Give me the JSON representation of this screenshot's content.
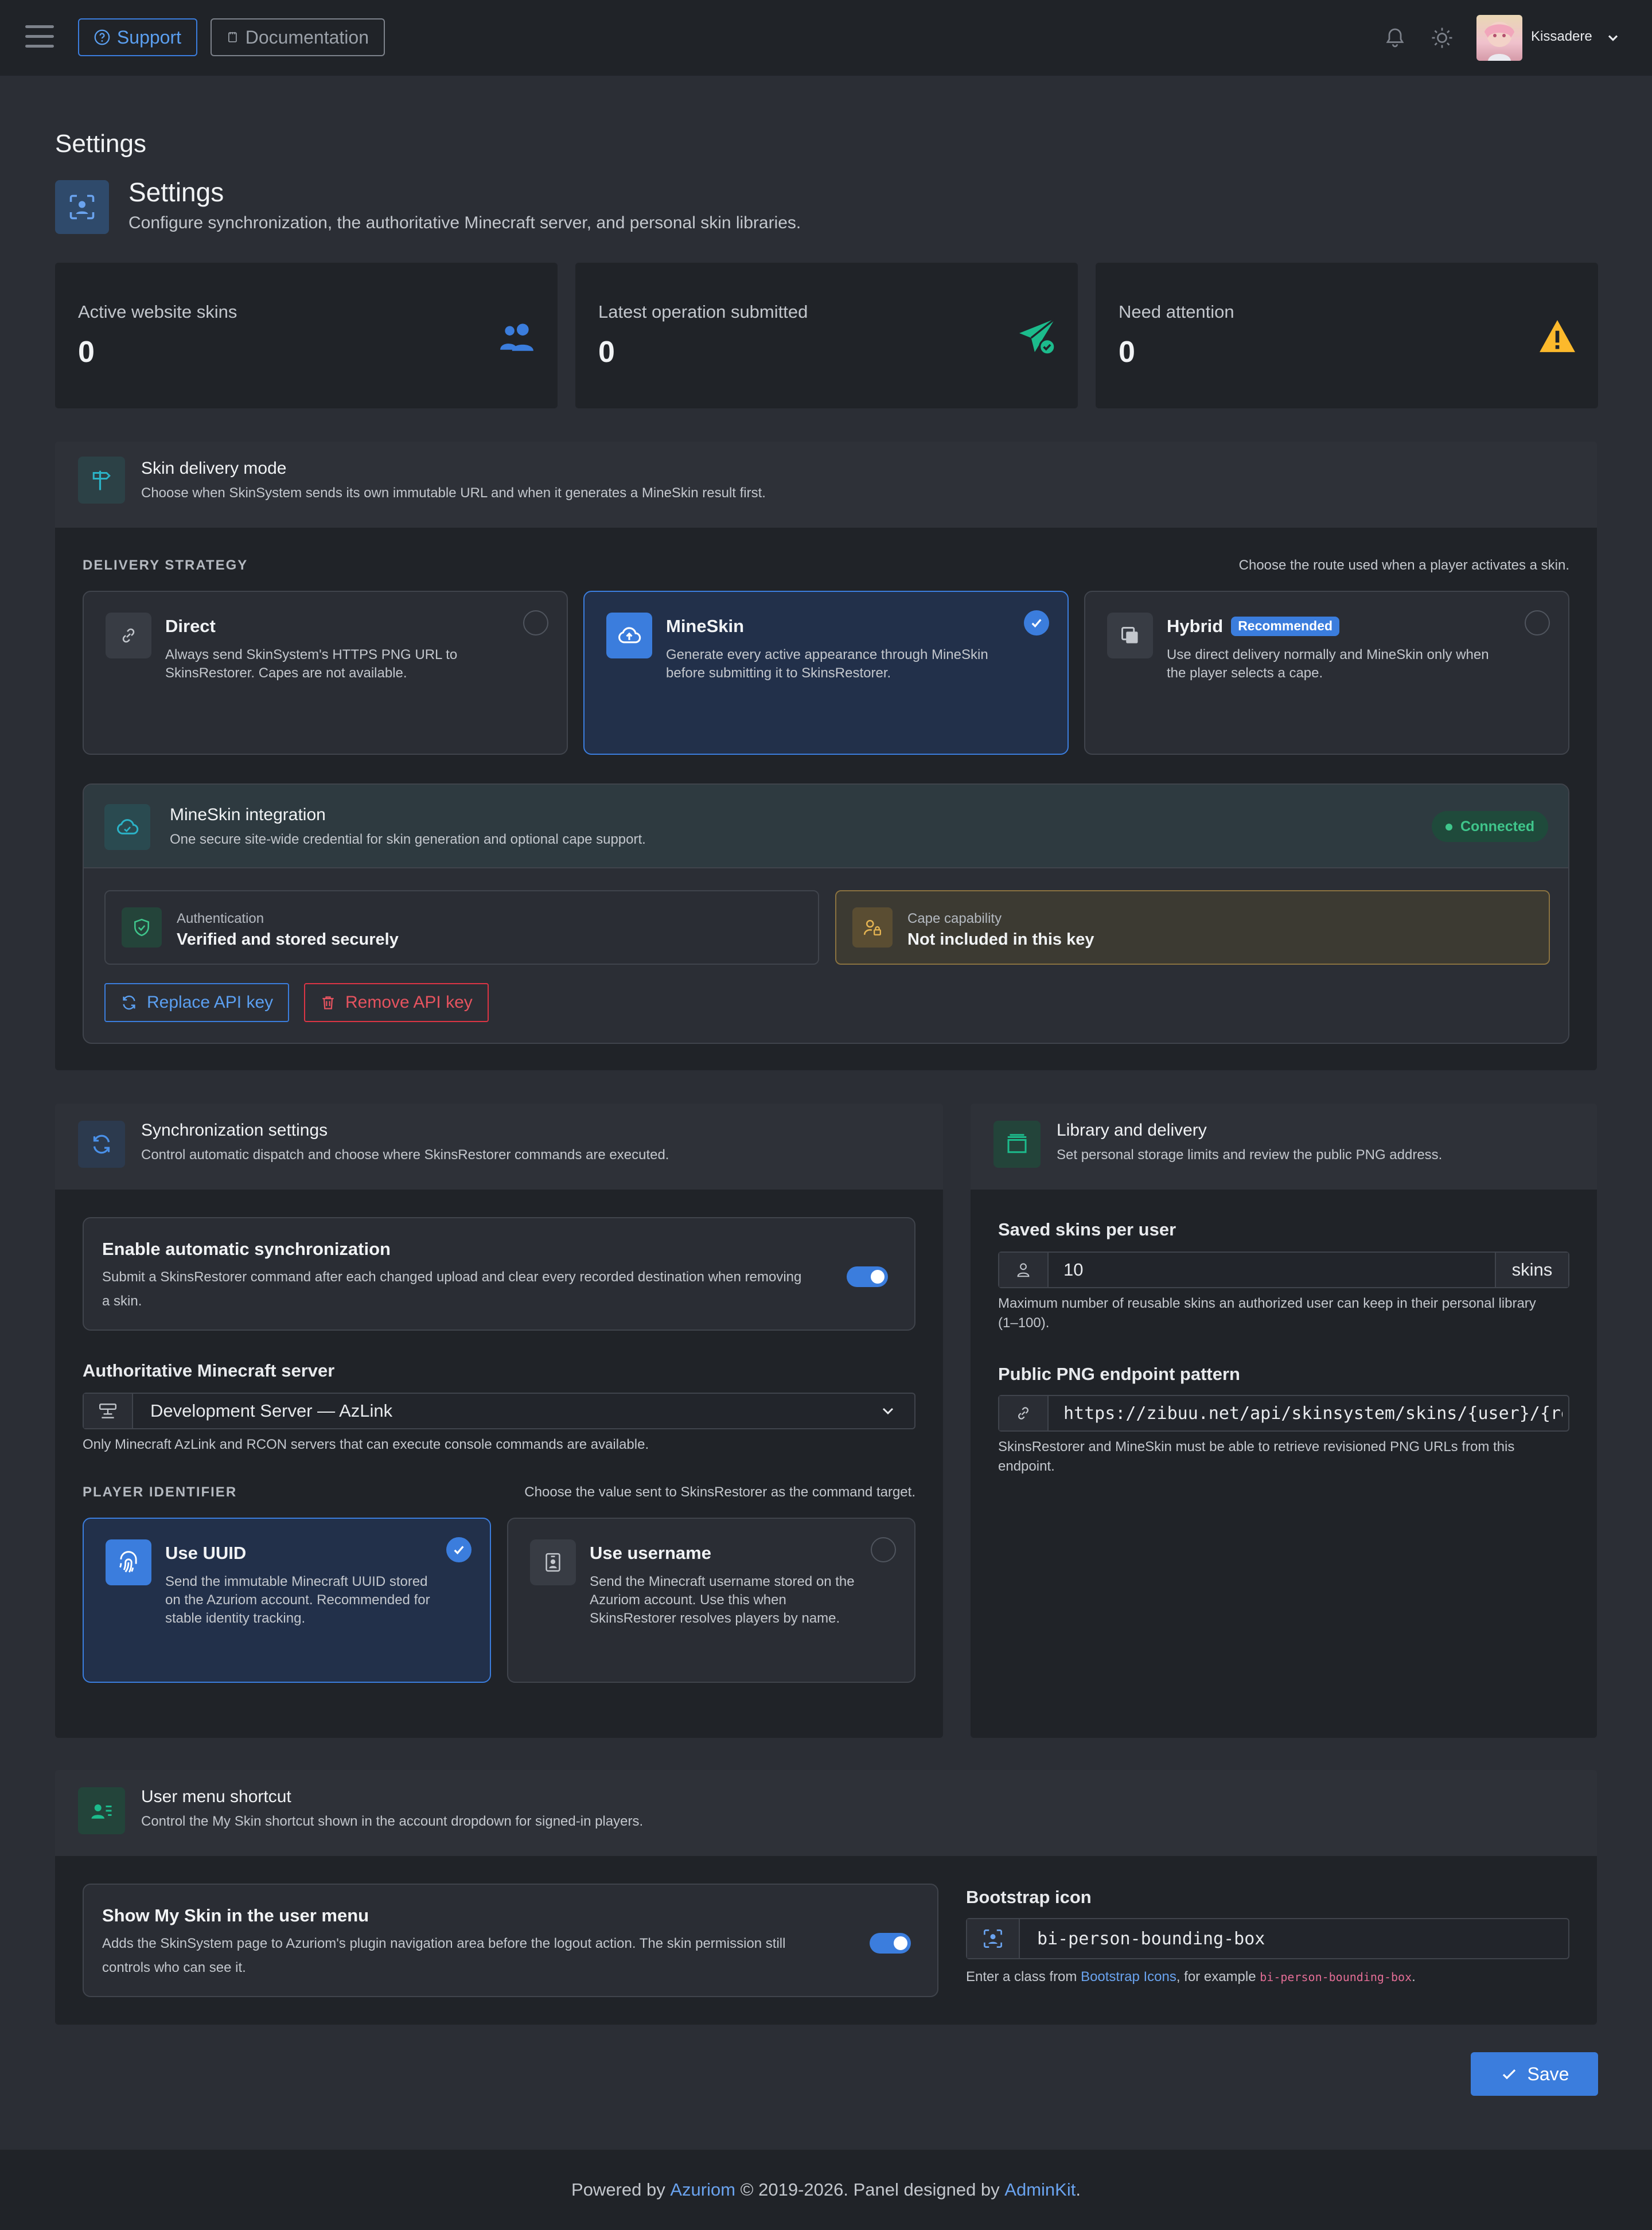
{
  "navbar": {
    "support_label": "Support",
    "docs_label": "Documentation",
    "username": "Kissadere"
  },
  "page": {
    "heading": "Settings",
    "title": "Settings",
    "subtitle": "Configure synchronization, the authoritative Minecraft server, and personal skin libraries."
  },
  "stats": [
    {
      "label": "Active website skins",
      "value": "0",
      "icon": "people-icon"
    },
    {
      "label": "Latest operation submitted",
      "value": "0",
      "icon": "send-check-icon"
    },
    {
      "label": "Need attention",
      "value": "0",
      "icon": "warning-icon"
    }
  ],
  "delivery": {
    "title": "Skin delivery mode",
    "subtitle": "Choose when SkinSystem sends its own immutable URL and when it generates a MineSkin result first.",
    "strategy_label": "DELIVERY STRATEGY",
    "strategy_hint": "Choose the route used when a player activates a skin.",
    "options": [
      {
        "title": "Direct",
        "desc1": "Always send SkinSystem's HTTPS PNG URL to",
        "desc2": "SkinsRestorer. Capes are not available.",
        "selected": false,
        "icon": "link-icon"
      },
      {
        "title": "MineSkin",
        "desc1": "Generate every active appearance through MineSkin",
        "desc2": "before submitting it to SkinsRestorer.",
        "selected": true,
        "icon": "cloud-upload-icon"
      },
      {
        "title": "Hybrid",
        "badge": "Recommended",
        "desc1": "Use direct delivery normally and MineSkin only when",
        "desc2": "the player selects a cape.",
        "selected": false,
        "icon": "layers-icon"
      }
    ],
    "integration": {
      "title": "MineSkin integration",
      "subtitle": "One secure site-wide credential for skin generation and optional cape support.",
      "status": "Connected",
      "auth_label": "Authentication",
      "auth_value": "Verified and stored securely",
      "cape_label": "Cape capability",
      "cape_value": "Not included in this key",
      "replace_label": "Replace API key",
      "remove_label": "Remove API key"
    }
  },
  "sync": {
    "title": "Synchronization settings",
    "subtitle": "Control automatic dispatch and choose where SkinsRestorer commands are executed.",
    "auto_title": "Enable automatic synchronization",
    "auto_desc1": "Submit a SkinsRestorer command after each changed upload and clear every recorded destination when removing",
    "auto_desc2": "a skin.",
    "auto_enabled": true,
    "server_label": "Authoritative Minecraft server",
    "server_value": "Development Server — AzLink",
    "server_help": "Only Minecraft AzLink and RCON servers that can execute console commands are available.",
    "identifier_label": "PLAYER IDENTIFIER",
    "identifier_hint": "Choose the value sent to SkinsRestorer as the command target.",
    "identifier_options": [
      {
        "title": "Use UUID",
        "desc1": "Send the immutable Minecraft UUID stored",
        "desc2": "on the Azuriom account. Recommended for",
        "desc3": "stable identity tracking.",
        "selected": true,
        "icon": "fingerprint-icon"
      },
      {
        "title": "Use username",
        "desc1": "Send the Minecraft username stored on the",
        "desc2": "Azuriom account. Use this when",
        "desc3": "SkinsRestorer resolves players by name.",
        "selected": false,
        "icon": "person-badge-icon"
      }
    ]
  },
  "library": {
    "title": "Library and delivery",
    "subtitle": "Set personal storage limits and review the public PNG address.",
    "saved_label": "Saved skins per user",
    "saved_value": "10",
    "saved_suffix": "skins",
    "saved_help1": "Maximum number of reusable skins an authorized user can keep in their personal library",
    "saved_help2": "(1–100).",
    "endpoint_label": "Public PNG endpoint pattern",
    "endpoint_value": "https://zibuu.net/api/skinsystem/skins/{user}/{re",
    "endpoint_help1": "SkinsRestorer and MineSkin must be able to retrieve revisioned PNG URLs from this",
    "endpoint_help2": "endpoint."
  },
  "usermenu": {
    "title": "User menu shortcut",
    "subtitle": "Control the My Skin shortcut shown in the account dropdown for signed-in players.",
    "show_title": "Show My Skin in the user menu",
    "show_desc1": "Adds the SkinSystem page to Azuriom's plugin navigation area before the logout action. The skin permission still",
    "show_desc2": "controls who can see it.",
    "show_enabled": true,
    "icon_label": "Bootstrap icon",
    "icon_value": "bi-person-bounding-box",
    "icon_help_prefix": "Enter a class from ",
    "icon_help_link": "Bootstrap Icons",
    "icon_help_middle": ", for example ",
    "icon_help_code": "bi-person-bounding-box",
    "icon_help_suffix": "."
  },
  "actions": {
    "save_label": "Save"
  },
  "footer": {
    "prefix": "Powered by ",
    "azuriom": "Azuriom",
    "middle": " © 2019-2026. Panel designed by ",
    "adminkit": "AdminKit",
    "suffix": "."
  },
  "colors": {
    "accent": "#3b7ddd",
    "success": "#3fc58b",
    "warning": "#fcb92c",
    "danger": "#dc3545",
    "background": "#2b2e35",
    "card": "#202328"
  }
}
